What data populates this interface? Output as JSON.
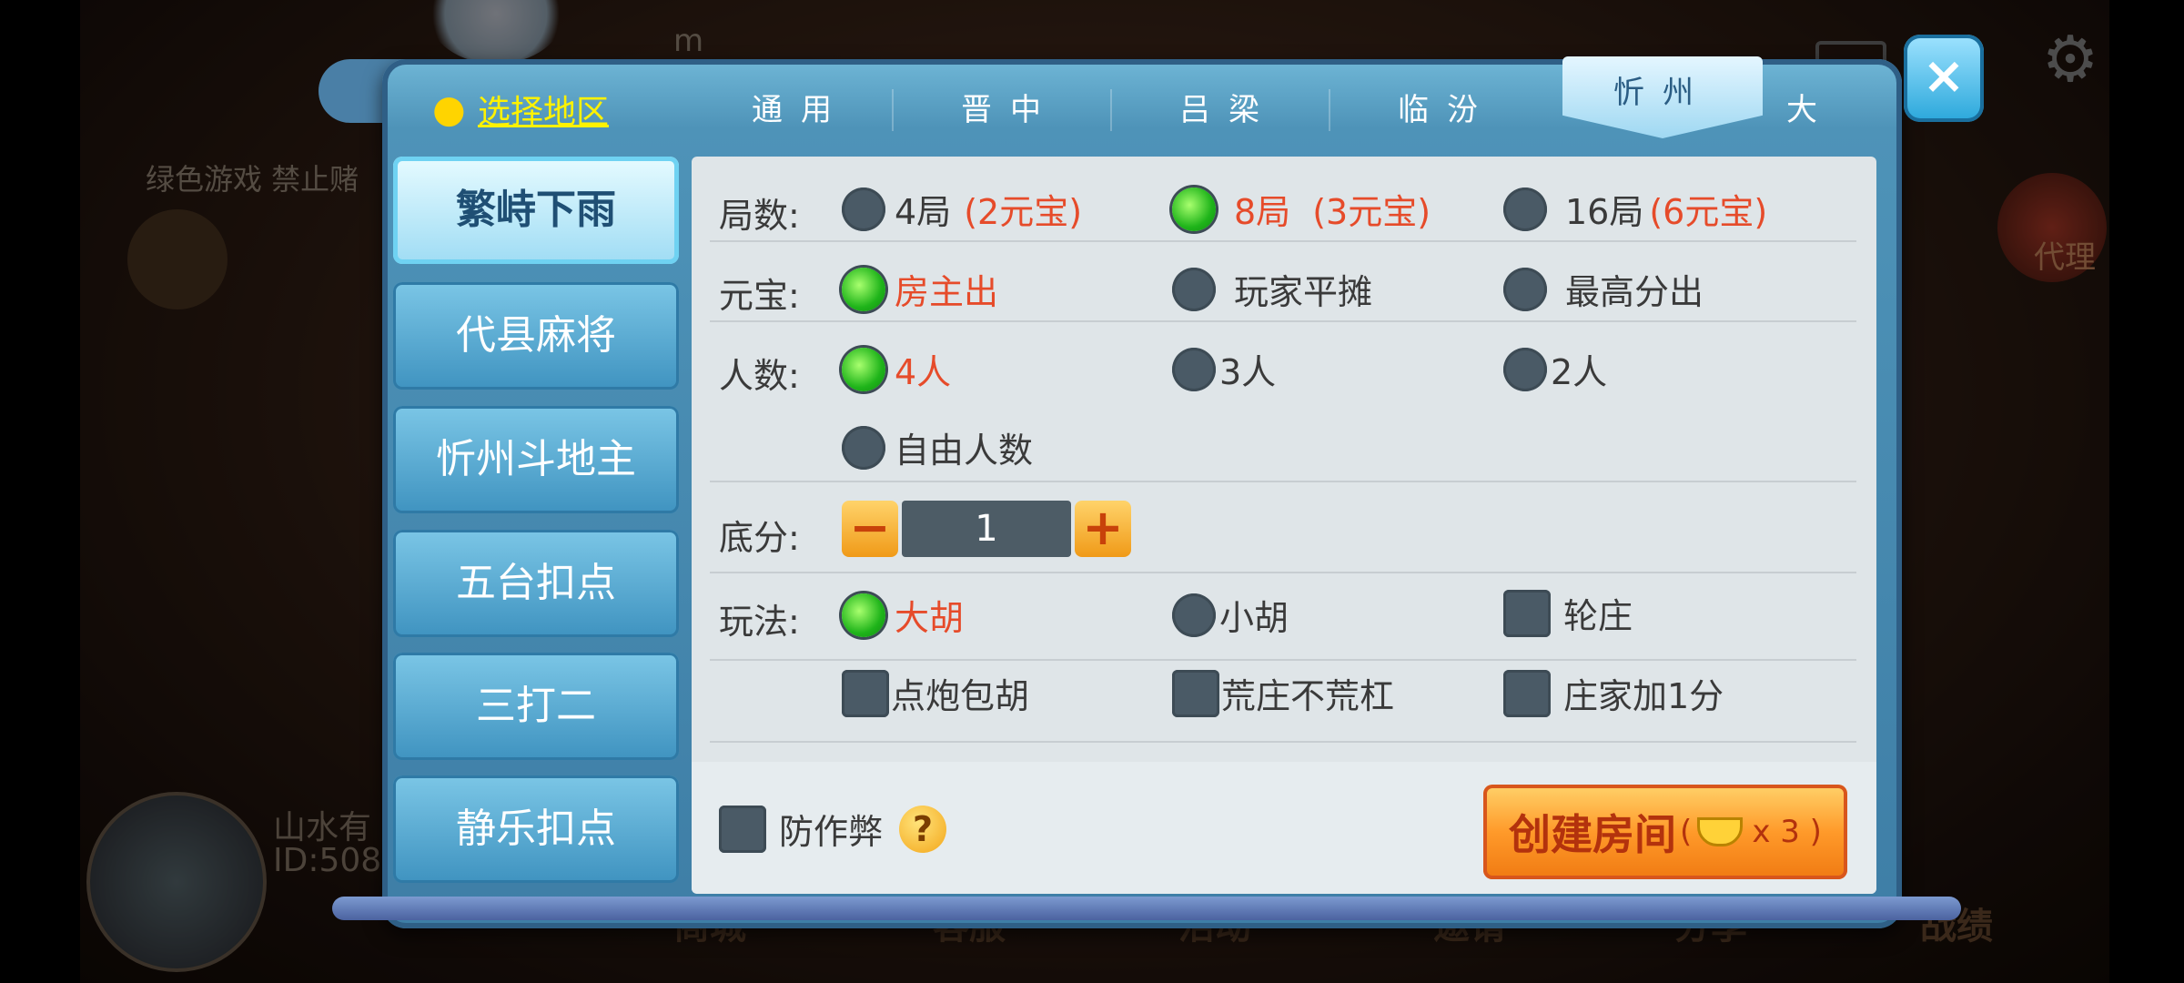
{
  "background": {
    "header_text": "m",
    "slogan": "绿色游戏 禁止赌",
    "agent_label": "代理",
    "user_name": "山水有",
    "user_id": "ID:508",
    "bottom_nav": [
      "商城",
      "客服",
      "活动",
      "邀请",
      "分享",
      "战绩"
    ]
  },
  "modal": {
    "location_label": "选择地区",
    "tabs": [
      "通用",
      "晋中",
      "吕梁",
      "临汾",
      "忻州",
      "大"
    ],
    "active_tab": "忻州",
    "close_label": "×",
    "side_items": [
      "繁峙下雨",
      "代县麻将",
      "忻州斗地主",
      "五台扣点",
      "三打二",
      "静乐扣点"
    ],
    "active_side_item": "繁峙下雨",
    "rounds": {
      "label": "局数:",
      "options": [
        {
          "text": "4局",
          "cost": "(2元宝)",
          "selected": false
        },
        {
          "text": "8局",
          "cost": "(3元宝)",
          "selected": true
        },
        {
          "text": "16局",
          "cost": "(6元宝)",
          "selected": false
        }
      ]
    },
    "payment": {
      "label": "元宝:",
      "options": [
        {
          "text": "房主出",
          "selected": true
        },
        {
          "text": "玩家平摊",
          "selected": false
        },
        {
          "text": "最高分出",
          "selected": false
        }
      ]
    },
    "players": {
      "label": "人数:",
      "options": [
        {
          "text": "4人",
          "selected": true
        },
        {
          "text": "3人",
          "selected": false
        },
        {
          "text": "2人",
          "selected": false
        },
        {
          "text": "自由人数",
          "selected": false
        }
      ]
    },
    "base_score": {
      "label": "底分:",
      "value": "1",
      "minus": "−",
      "plus": "+"
    },
    "play_mode": {
      "label": "玩法:",
      "radios": [
        {
          "text": "大胡",
          "selected": true
        },
        {
          "text": "小胡",
          "selected": false
        }
      ],
      "checks": [
        {
          "text": "轮庄",
          "checked": false
        },
        {
          "text": "点炮包胡",
          "checked": false
        },
        {
          "text": "荒庄不荒杠",
          "checked": false
        },
        {
          "text": "庄家加1分",
          "checked": false
        }
      ]
    },
    "anti_cheat_label": "防作弊",
    "help_label": "?",
    "create_button": {
      "label": "创建房间",
      "cost": "x 3 )",
      "open_paren": "("
    }
  },
  "colors": {
    "accent_red": "#e64b2a",
    "selected_green": "#1fb41a",
    "location_yellow": "#fff200",
    "panel_bg": "#dfe5e8"
  }
}
